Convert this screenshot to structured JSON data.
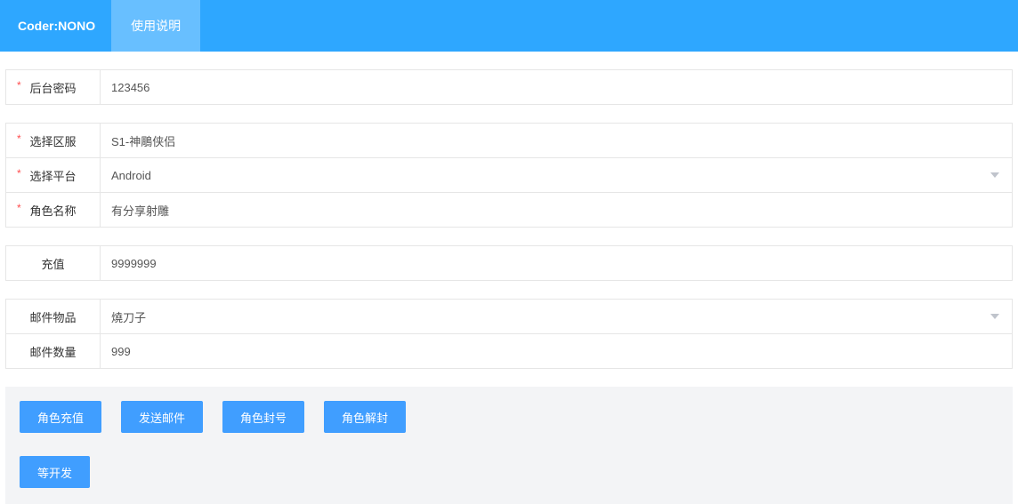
{
  "header": {
    "brand": "Coder:NONO",
    "tab_instructions": "使用说明"
  },
  "form": {
    "password": {
      "label": "后台密码",
      "value": "123456"
    },
    "server": {
      "label": "选择区服",
      "value": "S1-神鵰侠侣"
    },
    "platform": {
      "label": "选择平台",
      "value": "Android"
    },
    "role": {
      "label": "角色名称",
      "value": "有分享射雕"
    },
    "recharge": {
      "label": "充值",
      "value": "9999999"
    },
    "mailItem": {
      "label": "邮件物品",
      "value": "燒刀子"
    },
    "mailQty": {
      "label": "邮件数量",
      "value": "999"
    }
  },
  "actions": {
    "recharge": "角色充值",
    "sendMail": "发送邮件",
    "ban": "角色封号",
    "unban": "角色解封",
    "pending": "等开发"
  }
}
